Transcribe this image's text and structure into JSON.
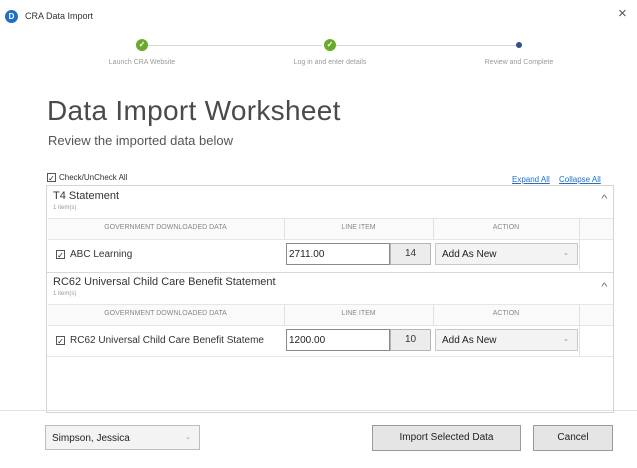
{
  "window": {
    "title": "CRA Data Import",
    "icon_glyph": "D",
    "close_glyph": "×"
  },
  "steps": [
    {
      "label": "Launch CRA Website",
      "status": "complete"
    },
    {
      "label": "Log in and enter details",
      "status": "complete"
    },
    {
      "label": "Review and Complete",
      "status": "current"
    }
  ],
  "step_check_glyph": "✓",
  "colors": {
    "step_complete": "#6aaa2a",
    "step_current": "#2f4f8f",
    "link": "#1f6fc5"
  },
  "page": {
    "title": "Data Import Worksheet",
    "subtitle": "Review the imported data below"
  },
  "check_all": {
    "label": "Check/UnCheck All",
    "checked": true,
    "glyph": "✓"
  },
  "links": {
    "expand_all": "Expand All",
    "collapse_all": "Collapse All"
  },
  "columns": {
    "data": "GOVERNMENT DOWNLOADED DATA",
    "line_item": "LINE ITEM",
    "action": "ACTION"
  },
  "sections": [
    {
      "title": "T4 Statement",
      "count": "1 item(s)",
      "expanded": true,
      "rows": [
        {
          "checked": true,
          "name": "ABC Learning",
          "amount": "2711.00",
          "line": "14",
          "action": "Add As New"
        }
      ]
    },
    {
      "title": "RC62 Universal Child Care Benefit Statement",
      "count": "1 item(s)",
      "expanded": true,
      "rows": [
        {
          "checked": true,
          "name": "RC62 Universal Child Care Benefit Stateme",
          "amount": "1200.00",
          "line": "10",
          "action": "Add As New"
        }
      ]
    }
  ],
  "icons": {
    "chevron_up": "^",
    "dropdown": "⌄"
  },
  "footer": {
    "user": "Simpson, Jessica",
    "import_button": "Import Selected Data",
    "cancel_button": "Cancel"
  }
}
